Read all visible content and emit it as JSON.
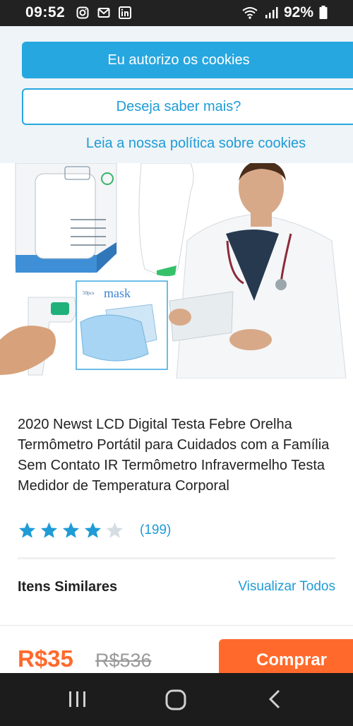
{
  "status_bar": {
    "time": "09:52",
    "battery": "92%",
    "icons": [
      "instagram-icon",
      "gmail-icon",
      "linkedin-icon",
      "wifi-icon",
      "signal-icon",
      "battery-icon"
    ]
  },
  "cookie_banner": {
    "accept_label": "Eu autorizo os cookies",
    "more_label": "Deseja saber mais?",
    "policy_link": "Leia a nossa política sobre cookies"
  },
  "product": {
    "image_text": {
      "box_label": "mask",
      "box_small": "50pcs"
    },
    "title": "2020 Newst LCD Digital Testa Febre Orelha Termômetro Portátil para Cuidados com a Família Sem Contato IR Termômetro Infravermelho Testa Medidor de Temperatura Corporal",
    "rating": 4,
    "rating_max": 5,
    "review_count": "(199)"
  },
  "similar": {
    "label": "Itens Similares",
    "view_all": "Visualizar Todos"
  },
  "purchase": {
    "price": "R$35",
    "old_price": "R$536",
    "buy_label": "Comprar"
  },
  "colors": {
    "accent_blue": "#27a7e0",
    "price_orange": "#ff6a2c",
    "star_blue": "#1f9bd6"
  }
}
